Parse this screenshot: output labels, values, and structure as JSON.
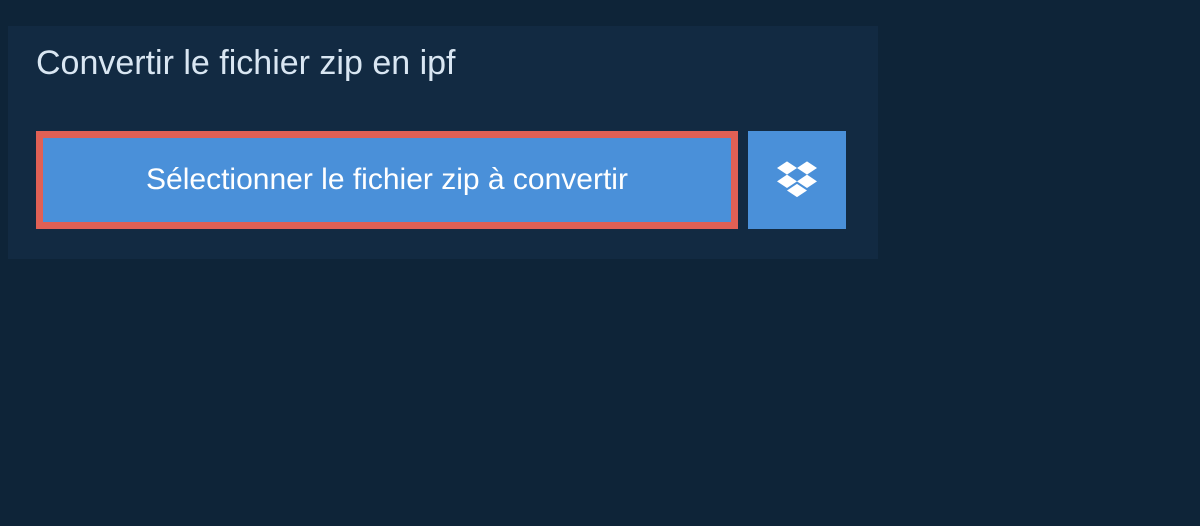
{
  "header": {
    "title": "Convertir le fichier zip en ipf"
  },
  "actions": {
    "select_file_label": "Sélectionner le fichier zip à convertir"
  }
}
